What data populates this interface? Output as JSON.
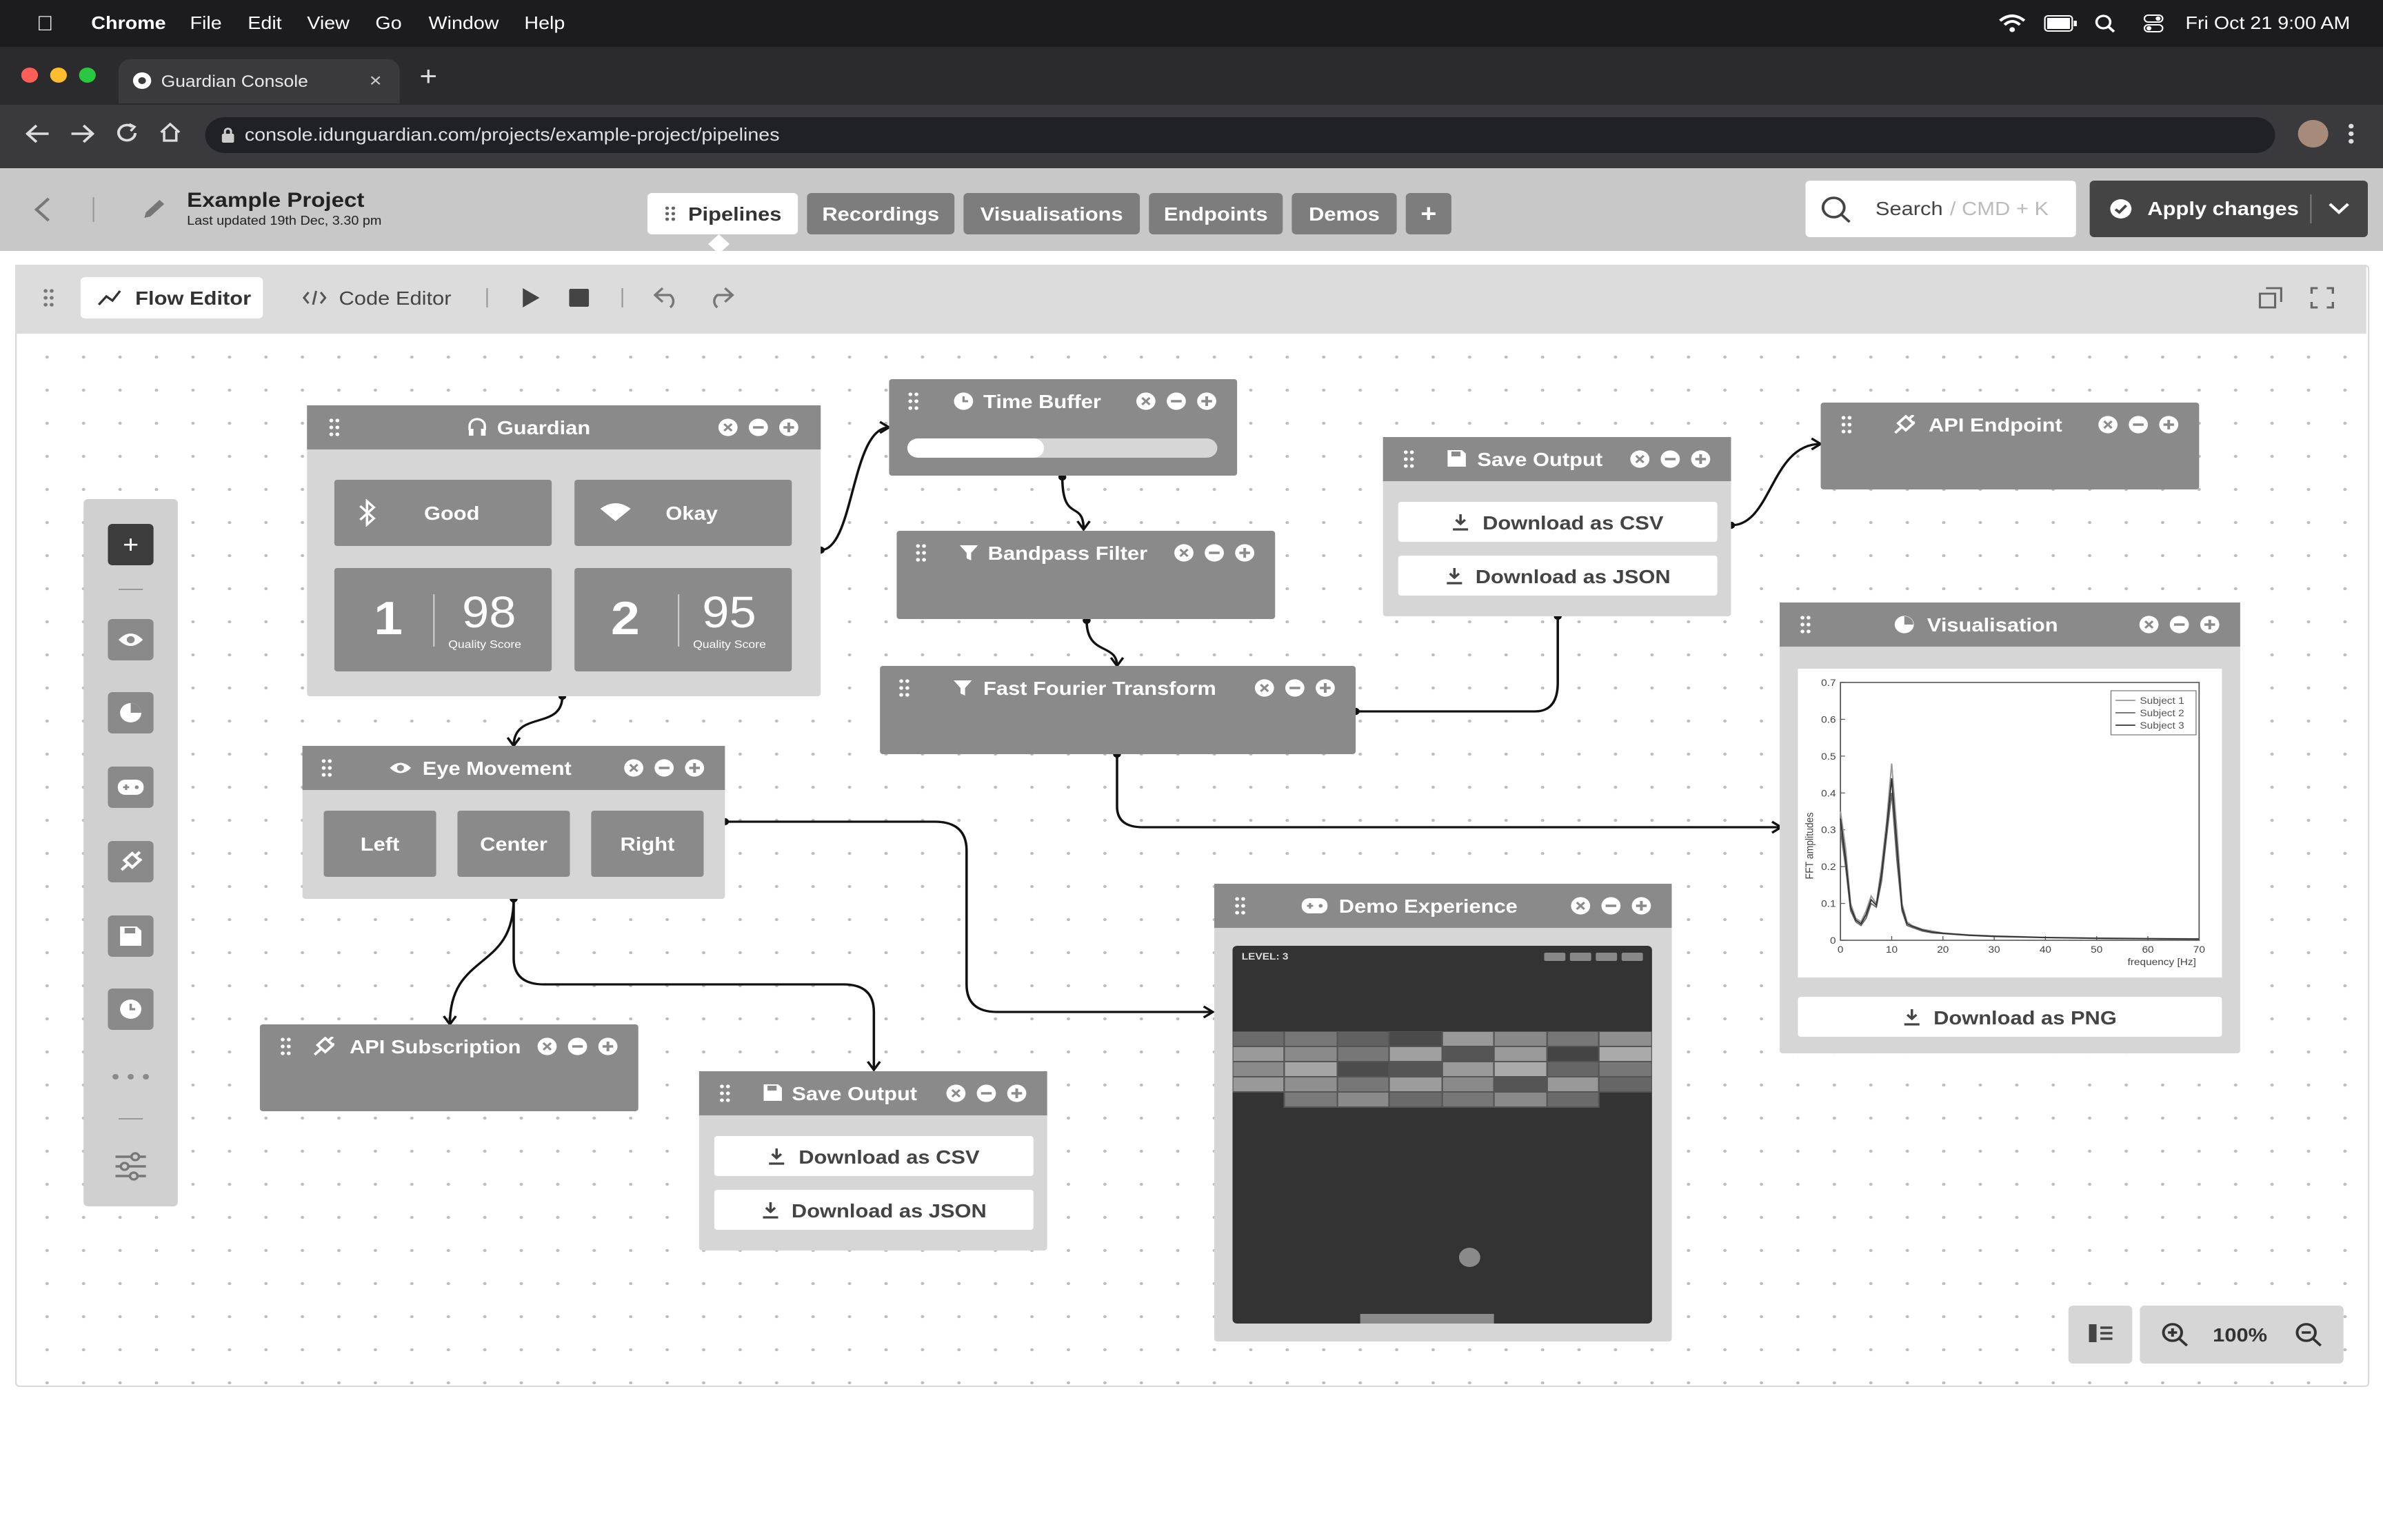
{
  "menubar": {
    "app": "Chrome",
    "items": [
      "File",
      "Edit",
      "View",
      "Go",
      "Window",
      "Help"
    ],
    "clock": "Fri Oct 21  9:00 AM"
  },
  "browser": {
    "tab_title": "Guardian Console",
    "url": "console.idunguardian.com/projects/example-project/pipelines"
  },
  "header": {
    "project_name": "Example Project",
    "last_updated": "Last updated 19th Dec, 3.30 pm",
    "tabs": [
      "Pipelines",
      "Recordings",
      "Visualisations",
      "Endpoints",
      "Demos"
    ],
    "add_tab": "+",
    "search_label": "Search",
    "search_shortcut": "/  CMD + K",
    "apply_label": "Apply changes"
  },
  "editor_toolbar": {
    "flow_editor": "Flow Editor",
    "code_editor": "Code Editor"
  },
  "nodes": {
    "guardian": {
      "title": "Guardian",
      "bluetooth_status": "Good",
      "wifi_status": "Okay",
      "channel1_num": "1",
      "channel1_score": "98",
      "channel2_num": "2",
      "channel2_score": "95",
      "quality_label": "Quality Score"
    },
    "time_buffer": {
      "title": "Time Buffer",
      "progress": 0.44
    },
    "bandpass": {
      "title": "Bandpass Filter"
    },
    "fft": {
      "title": "Fast Fourier Transform"
    },
    "save_output_top": {
      "title": "Save Output",
      "csv": "Download as CSV",
      "json": "Download as JSON"
    },
    "api_endpoint": {
      "title": "API Endpoint"
    },
    "eye_movement": {
      "title": "Eye Movement",
      "left": "Left",
      "center": "Center",
      "right": "Right"
    },
    "api_subscription": {
      "title": "API Subscription"
    },
    "save_output_bottom": {
      "title": "Save Output",
      "csv": "Download as CSV",
      "json": "Download as JSON"
    },
    "demo_experience": {
      "title": "Demo Experience",
      "level": "LEVEL: 3"
    },
    "visualisation": {
      "title": "Visualisation",
      "download": "Download as PNG"
    }
  },
  "zoom": {
    "level": "100%"
  },
  "chart_data": {
    "type": "line",
    "xlabel": "frequency [Hz]",
    "ylabel": "FFT amplitudes",
    "xlim": [
      0,
      70
    ],
    "ylim": [
      0,
      0.7
    ],
    "xticks": [
      0,
      10,
      20,
      30,
      40,
      50,
      60,
      70
    ],
    "yticks": [
      0,
      0.1,
      0.2,
      0.3,
      0.4,
      0.5,
      0.6,
      0.7
    ],
    "legend_position": "top-right",
    "x": [
      0,
      1,
      2,
      3,
      4,
      5,
      6,
      7,
      8,
      9,
      10,
      11,
      12,
      13,
      14,
      16,
      18,
      20,
      25,
      30,
      40,
      50,
      60,
      70
    ],
    "series": [
      {
        "name": "Subject 1",
        "values": [
          0.35,
          0.25,
          0.1,
          0.06,
          0.05,
          0.08,
          0.12,
          0.1,
          0.2,
          0.32,
          0.48,
          0.3,
          0.1,
          0.05,
          0.04,
          0.03,
          0.025,
          0.02,
          0.015,
          0.012,
          0.008,
          0.006,
          0.005,
          0.004
        ]
      },
      {
        "name": "Subject 2",
        "values": [
          0.3,
          0.2,
          0.08,
          0.05,
          0.04,
          0.06,
          0.1,
          0.09,
          0.16,
          0.28,
          0.4,
          0.22,
          0.08,
          0.04,
          0.035,
          0.025,
          0.02,
          0.018,
          0.013,
          0.01,
          0.007,
          0.005,
          0.004,
          0.003
        ]
      },
      {
        "name": "Subject 3",
        "values": [
          0.33,
          0.22,
          0.09,
          0.055,
          0.045,
          0.07,
          0.11,
          0.095,
          0.18,
          0.3,
          0.44,
          0.26,
          0.09,
          0.045,
          0.038,
          0.028,
          0.022,
          0.019,
          0.014,
          0.011,
          0.0075,
          0.0055,
          0.0045,
          0.0035
        ]
      }
    ]
  }
}
